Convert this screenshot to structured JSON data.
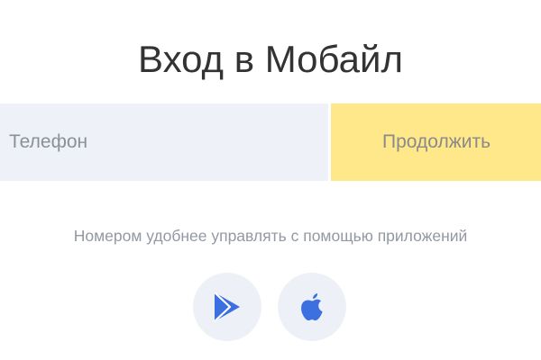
{
  "title": "Вход в Мобайл",
  "login": {
    "phone_placeholder": "Телефон",
    "phone_value": "",
    "continue_label": "Продолжить"
  },
  "hint": "Номером удобнее управлять с помощью приложений",
  "store_links": [
    {
      "icon": "google-play-icon"
    },
    {
      "icon": "apple-icon"
    }
  ],
  "colors": {
    "accent_yellow": "#ffe88a",
    "field_bg": "#eef2f8",
    "icon_blue": "#3c6fe0"
  }
}
